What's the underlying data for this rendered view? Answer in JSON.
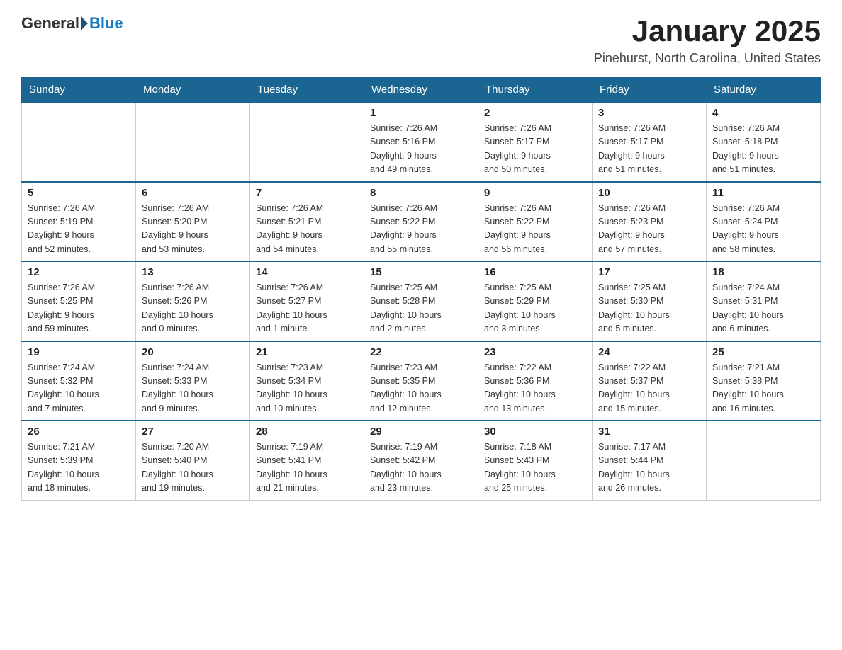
{
  "header": {
    "logo_general": "General",
    "logo_blue": "Blue",
    "month_title": "January 2025",
    "location": "Pinehurst, North Carolina, United States"
  },
  "weekdays": [
    "Sunday",
    "Monday",
    "Tuesday",
    "Wednesday",
    "Thursday",
    "Friday",
    "Saturday"
  ],
  "weeks": [
    [
      {
        "day": "",
        "info": ""
      },
      {
        "day": "",
        "info": ""
      },
      {
        "day": "",
        "info": ""
      },
      {
        "day": "1",
        "info": "Sunrise: 7:26 AM\nSunset: 5:16 PM\nDaylight: 9 hours\nand 49 minutes."
      },
      {
        "day": "2",
        "info": "Sunrise: 7:26 AM\nSunset: 5:17 PM\nDaylight: 9 hours\nand 50 minutes."
      },
      {
        "day": "3",
        "info": "Sunrise: 7:26 AM\nSunset: 5:17 PM\nDaylight: 9 hours\nand 51 minutes."
      },
      {
        "day": "4",
        "info": "Sunrise: 7:26 AM\nSunset: 5:18 PM\nDaylight: 9 hours\nand 51 minutes."
      }
    ],
    [
      {
        "day": "5",
        "info": "Sunrise: 7:26 AM\nSunset: 5:19 PM\nDaylight: 9 hours\nand 52 minutes."
      },
      {
        "day": "6",
        "info": "Sunrise: 7:26 AM\nSunset: 5:20 PM\nDaylight: 9 hours\nand 53 minutes."
      },
      {
        "day": "7",
        "info": "Sunrise: 7:26 AM\nSunset: 5:21 PM\nDaylight: 9 hours\nand 54 minutes."
      },
      {
        "day": "8",
        "info": "Sunrise: 7:26 AM\nSunset: 5:22 PM\nDaylight: 9 hours\nand 55 minutes."
      },
      {
        "day": "9",
        "info": "Sunrise: 7:26 AM\nSunset: 5:22 PM\nDaylight: 9 hours\nand 56 minutes."
      },
      {
        "day": "10",
        "info": "Sunrise: 7:26 AM\nSunset: 5:23 PM\nDaylight: 9 hours\nand 57 minutes."
      },
      {
        "day": "11",
        "info": "Sunrise: 7:26 AM\nSunset: 5:24 PM\nDaylight: 9 hours\nand 58 minutes."
      }
    ],
    [
      {
        "day": "12",
        "info": "Sunrise: 7:26 AM\nSunset: 5:25 PM\nDaylight: 9 hours\nand 59 minutes."
      },
      {
        "day": "13",
        "info": "Sunrise: 7:26 AM\nSunset: 5:26 PM\nDaylight: 10 hours\nand 0 minutes."
      },
      {
        "day": "14",
        "info": "Sunrise: 7:26 AM\nSunset: 5:27 PM\nDaylight: 10 hours\nand 1 minute."
      },
      {
        "day": "15",
        "info": "Sunrise: 7:25 AM\nSunset: 5:28 PM\nDaylight: 10 hours\nand 2 minutes."
      },
      {
        "day": "16",
        "info": "Sunrise: 7:25 AM\nSunset: 5:29 PM\nDaylight: 10 hours\nand 3 minutes."
      },
      {
        "day": "17",
        "info": "Sunrise: 7:25 AM\nSunset: 5:30 PM\nDaylight: 10 hours\nand 5 minutes."
      },
      {
        "day": "18",
        "info": "Sunrise: 7:24 AM\nSunset: 5:31 PM\nDaylight: 10 hours\nand 6 minutes."
      }
    ],
    [
      {
        "day": "19",
        "info": "Sunrise: 7:24 AM\nSunset: 5:32 PM\nDaylight: 10 hours\nand 7 minutes."
      },
      {
        "day": "20",
        "info": "Sunrise: 7:24 AM\nSunset: 5:33 PM\nDaylight: 10 hours\nand 9 minutes."
      },
      {
        "day": "21",
        "info": "Sunrise: 7:23 AM\nSunset: 5:34 PM\nDaylight: 10 hours\nand 10 minutes."
      },
      {
        "day": "22",
        "info": "Sunrise: 7:23 AM\nSunset: 5:35 PM\nDaylight: 10 hours\nand 12 minutes."
      },
      {
        "day": "23",
        "info": "Sunrise: 7:22 AM\nSunset: 5:36 PM\nDaylight: 10 hours\nand 13 minutes."
      },
      {
        "day": "24",
        "info": "Sunrise: 7:22 AM\nSunset: 5:37 PM\nDaylight: 10 hours\nand 15 minutes."
      },
      {
        "day": "25",
        "info": "Sunrise: 7:21 AM\nSunset: 5:38 PM\nDaylight: 10 hours\nand 16 minutes."
      }
    ],
    [
      {
        "day": "26",
        "info": "Sunrise: 7:21 AM\nSunset: 5:39 PM\nDaylight: 10 hours\nand 18 minutes."
      },
      {
        "day": "27",
        "info": "Sunrise: 7:20 AM\nSunset: 5:40 PM\nDaylight: 10 hours\nand 19 minutes."
      },
      {
        "day": "28",
        "info": "Sunrise: 7:19 AM\nSunset: 5:41 PM\nDaylight: 10 hours\nand 21 minutes."
      },
      {
        "day": "29",
        "info": "Sunrise: 7:19 AM\nSunset: 5:42 PM\nDaylight: 10 hours\nand 23 minutes."
      },
      {
        "day": "30",
        "info": "Sunrise: 7:18 AM\nSunset: 5:43 PM\nDaylight: 10 hours\nand 25 minutes."
      },
      {
        "day": "31",
        "info": "Sunrise: 7:17 AM\nSunset: 5:44 PM\nDaylight: 10 hours\nand 26 minutes."
      },
      {
        "day": "",
        "info": ""
      }
    ]
  ]
}
